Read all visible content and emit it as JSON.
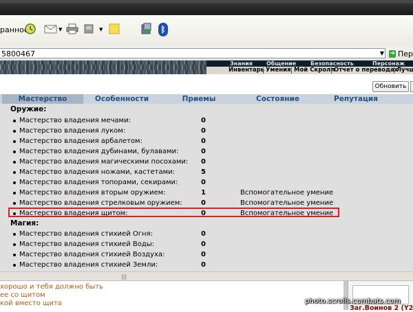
{
  "toolbar": {
    "favorites_fragment": "ранное",
    "bluetooth_label": "ᛒ"
  },
  "address": {
    "url_fragment": "5800467",
    "go_label": "Пер"
  },
  "game_menu": {
    "top": [
      "Знания",
      "Общение",
      "Безопасность",
      "Персонаж"
    ],
    "bottom": [
      "Инвентарь",
      "Умения",
      "Мой Скролл",
      "Отчет о переводах",
      "Лучшие"
    ]
  },
  "refresh_label": "Обновить",
  "tabs": [
    "Мастерство",
    "Особенности",
    "Приемы",
    "Состояние",
    "Репутация"
  ],
  "sections": [
    {
      "title": "Оружие:",
      "rows": [
        {
          "name": "Мастерство владения мечами:",
          "value": "0",
          "state": ""
        },
        {
          "name": "Мастерство владения луком:",
          "value": "0",
          "state": ""
        },
        {
          "name": "Мастерство владения арбалетом:",
          "value": "0",
          "state": ""
        },
        {
          "name": "Мастерство владения дубинами, булавами:",
          "value": "0",
          "state": ""
        },
        {
          "name": "Мастерство владения магическими посохами:",
          "value": "0",
          "state": ""
        },
        {
          "name": "Мастерство владения ножами, кастетами:",
          "value": "5",
          "state": ""
        },
        {
          "name": "Мастерство владения топорами, секирами:",
          "value": "0",
          "state": ""
        },
        {
          "name": "Мастерство владения вторым оружием:",
          "value": "1",
          "state": "Вспомогательное умение"
        },
        {
          "name": "Мастерство владения стрелковым оружием:",
          "value": "0",
          "state": "Вспомогательное умение"
        },
        {
          "name": "Мастерство владения щитом:",
          "value": "0",
          "state": "Вспомогательное умение"
        }
      ]
    },
    {
      "title": "Магия:",
      "rows": [
        {
          "name": "Мастерство владения стихией Огня:",
          "value": "0",
          "state": ""
        },
        {
          "name": "Мастерство владения стихией Воды:",
          "value": "0",
          "state": ""
        },
        {
          "name": "Мастерство владения стихией Воздуха:",
          "value": "0",
          "state": ""
        },
        {
          "name": "Мастерство владения стихией Земли:",
          "value": "0",
          "state": ""
        }
      ]
    }
  ],
  "chat": [
    "хорошо и тебя должно быть",
    "ее со щитом",
    "кой вместо щита"
  ],
  "bottom_status": "Заг.Воинов 2 (Y2",
  "watermark": "photo.scrolls.combats.com",
  "colors": {
    "tab_text": "#254f86",
    "highlight": "#d61f26",
    "chat_text": "#b05a17",
    "bottom_status": "#7a1000"
  }
}
